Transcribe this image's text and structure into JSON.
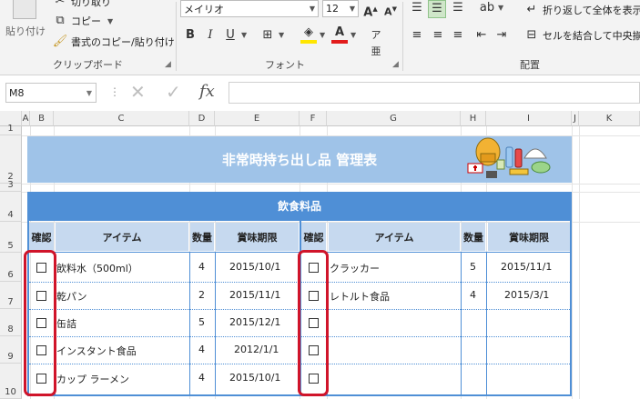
{
  "ribbon": {
    "clipboard": {
      "paste_label": "貼り付け",
      "cut_label": "切り取り",
      "copy_label": "コピー",
      "format_painter_label": "書式のコピー/貼り付け",
      "group_label": "クリップボード"
    },
    "font": {
      "font_name": "メイリオ",
      "font_size": "12",
      "group_label": "フォント",
      "bold": "B",
      "italic": "I",
      "underline": "U"
    },
    "alignment": {
      "wrap_text_label": "折り返して全体を表示する",
      "merge_label": "セルを結合して中央揃え",
      "group_label": "配置"
    }
  },
  "formula_bar": {
    "name_box": "M8",
    "fx": "fx",
    "value": ""
  },
  "columns": [
    "A",
    "B",
    "C",
    "D",
    "E",
    "F",
    "G",
    "H",
    "I",
    "J",
    "K"
  ],
  "rows": [
    "1",
    "2",
    "3",
    "4",
    "5",
    "6",
    "7",
    "8",
    "9",
    "10"
  ],
  "sheet": {
    "title": "非常時持ち出し品 管理表",
    "section": "飲食料品",
    "headers": [
      "確認",
      "アイテム",
      "数量",
      "賞味期限",
      "確認",
      "アイテム",
      "数量",
      "賞味期限"
    ],
    "left_items": [
      {
        "item": "飲料水（500ml）",
        "qty": "4",
        "date": "2015/10/1"
      },
      {
        "item": "乾パン",
        "qty": "2",
        "date": "2015/11/1"
      },
      {
        "item": "缶詰",
        "qty": "5",
        "date": "2015/12/1"
      },
      {
        "item": "インスタント食品",
        "qty": "4",
        "date": "2012/1/1"
      },
      {
        "item": "カップ ラーメン",
        "qty": "4",
        "date": "2015/10/1"
      }
    ],
    "right_items": [
      {
        "item": "クラッカー",
        "qty": "5",
        "date": "2015/11/1"
      },
      {
        "item": "レトルト食品",
        "qty": "4",
        "date": "2015/3/1"
      },
      {
        "item": "",
        "qty": "",
        "date": ""
      },
      {
        "item": "",
        "qty": "",
        "date": ""
      },
      {
        "item": "",
        "qty": "",
        "date": ""
      }
    ]
  },
  "colors": {
    "title_fill": "#9fc3e8",
    "section_fill": "#4f8fd6",
    "header_fill": "#c6d9ef",
    "highlight": "#d0142a"
  }
}
